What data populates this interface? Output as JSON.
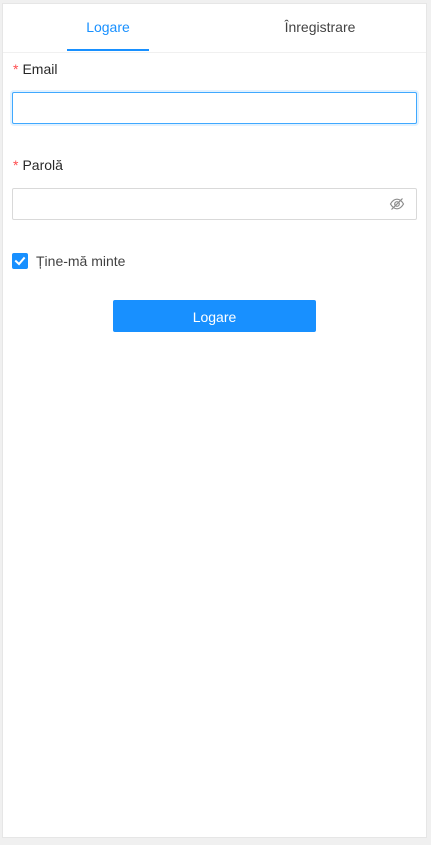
{
  "tabs": {
    "login_label": "Logare",
    "register_label": "Înregistrare",
    "active": "login"
  },
  "form": {
    "email": {
      "required_mark": "*",
      "label": "Email",
      "value": "",
      "placeholder": ""
    },
    "password": {
      "required_mark": "*",
      "label": "Parolă",
      "value": "",
      "placeholder": "",
      "toggle_icon": "eye-invisible-icon"
    },
    "remember": {
      "label": "Ține-mă minte",
      "checked": true
    },
    "submit_label": "Logare"
  },
  "colors": {
    "primary": "#1890ff",
    "required": "#ff4d4f"
  }
}
